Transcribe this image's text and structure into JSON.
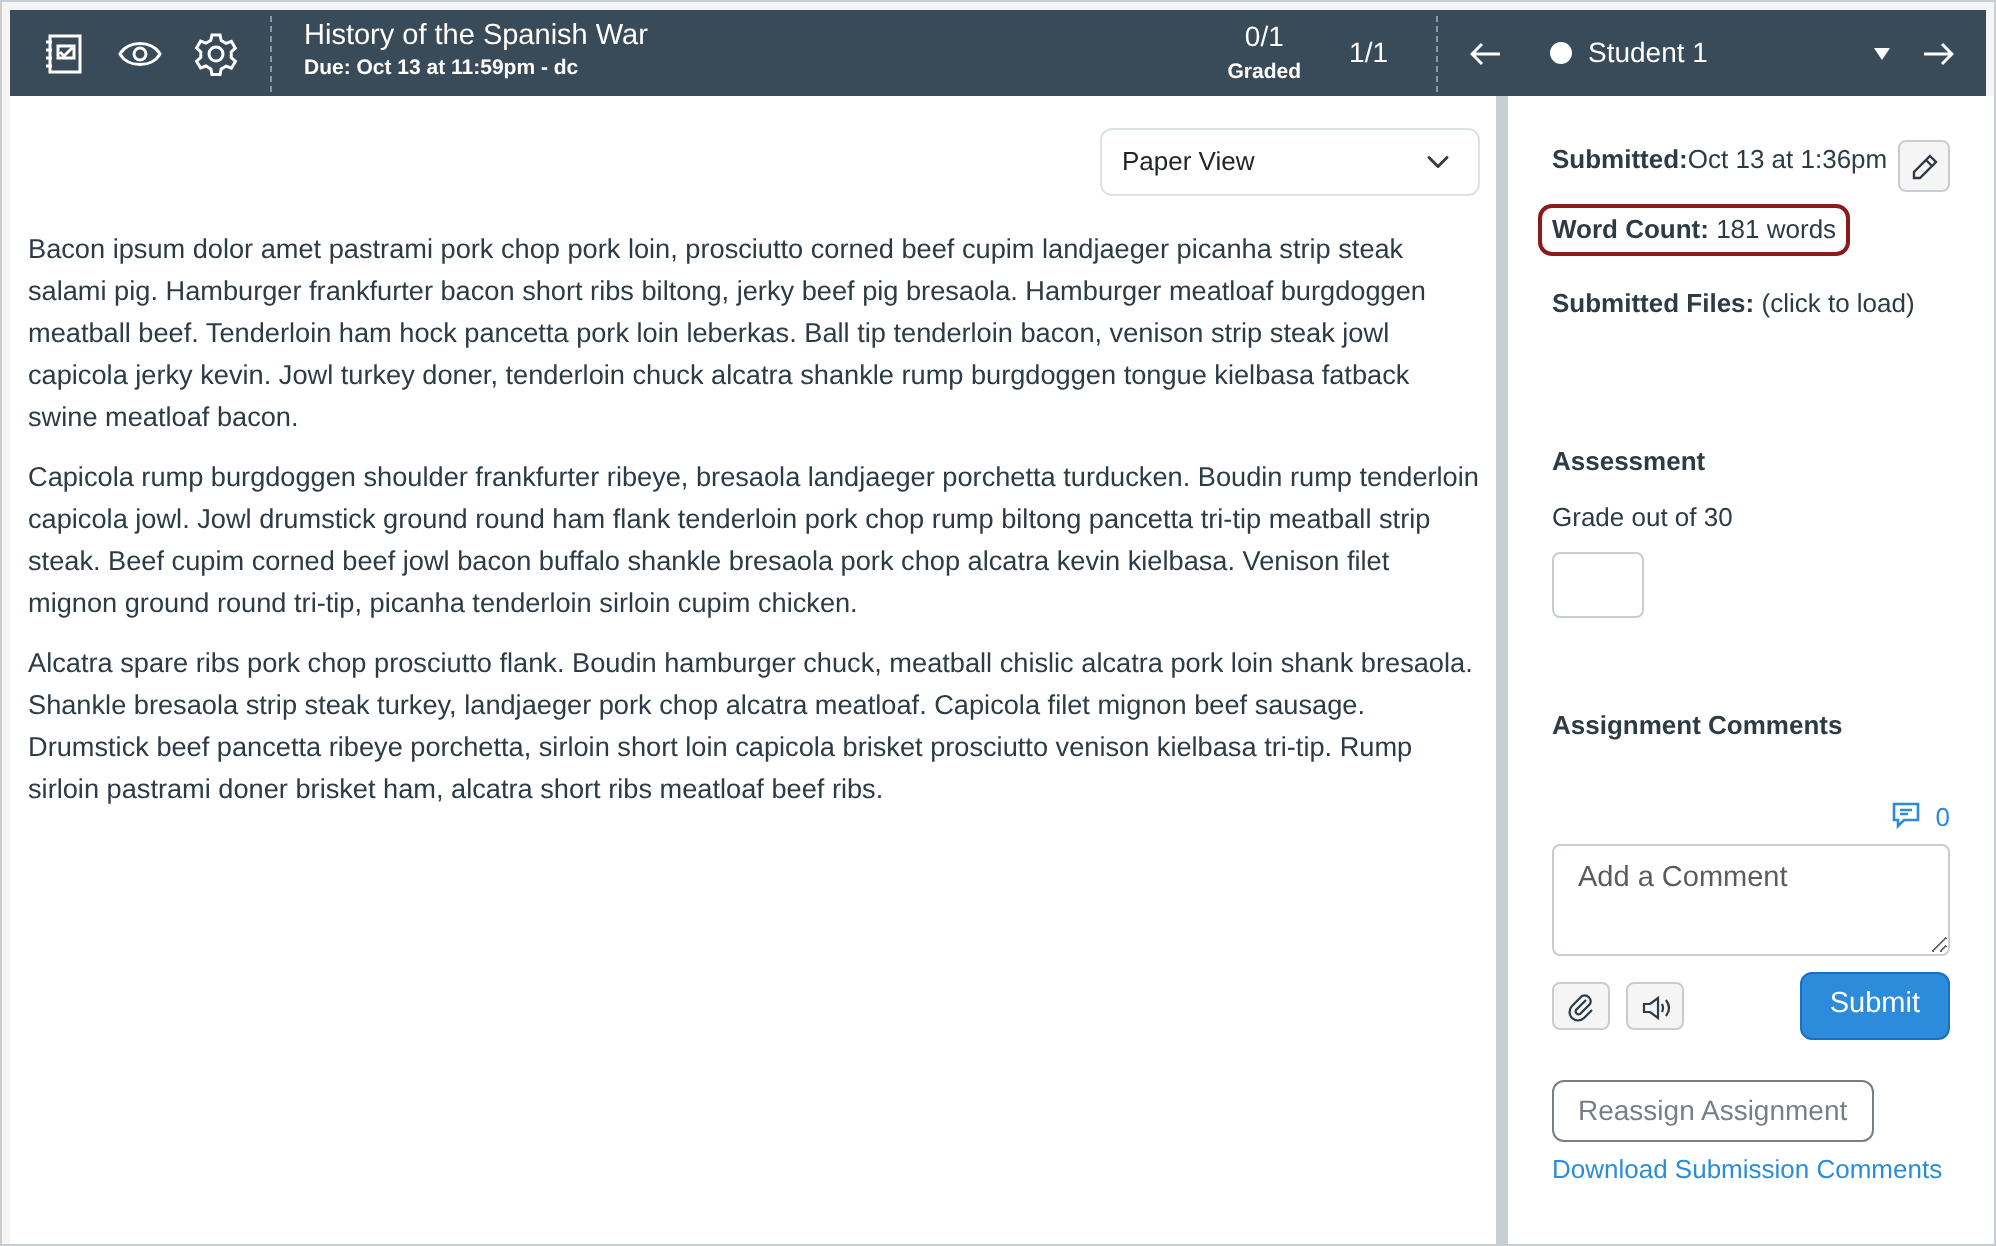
{
  "header": {
    "title": "History of the Spanish War",
    "due": "Due: Oct 13 at 11:59pm - dc",
    "graded_count": "0/1",
    "graded_label": "Graded",
    "position": "1/1",
    "student": "Student 1"
  },
  "submission": {
    "view_select": "Paper View",
    "paragraphs": [
      "Bacon ipsum dolor amet pastrami pork chop pork loin, prosciutto corned beef cupim landjaeger picanha strip steak salami pig. Hamburger frankfurter bacon short ribs biltong, jerky beef pig bresaola. Hamburger meatloaf burgdoggen meatball beef. Tenderloin ham hock pancetta pork loin leberkas. Ball tip tenderloin bacon, venison strip steak jowl capicola jerky kevin. Jowl turkey doner, tenderloin chuck alcatra shankle rump burgdoggen tongue kielbasa fatback swine meatloaf bacon.",
      "Capicola rump burgdoggen shoulder frankfurter ribeye, bresaola landjaeger porchetta turducken. Boudin rump tenderloin capicola jowl. Jowl drumstick ground round ham flank tenderloin pork chop rump biltong pancetta tri-tip meatball strip steak. Beef cupim corned beef jowl bacon buffalo shankle bresaola pork chop alcatra kevin kielbasa. Venison filet mignon ground round tri-tip, picanha tenderloin sirloin cupim chicken.",
      "Alcatra spare ribs pork chop prosciutto flank. Boudin hamburger chuck, meatball chislic alcatra pork loin shank bresaola. Shankle bresaola strip steak turkey, landjaeger pork chop alcatra meatloaf. Capicola filet mignon beef sausage. Drumstick beef pancetta ribeye porchetta, sirloin short loin capicola brisket prosciutto venison kielbasa tri-tip. Rump sirloin pastrami doner brisket ham, alcatra short ribs meatloaf beef ribs."
    ]
  },
  "sidebar": {
    "details": [
      {
        "label": "Submitted:",
        "value": "Oct 13 at 1:36pm",
        "highlighted": false
      },
      {
        "label": "Word Count:",
        "value": " 181 words",
        "highlighted": true
      },
      {
        "label": "Submitted Files:",
        "value": " (click to load)",
        "highlighted": false
      }
    ],
    "assessment_heading": "Assessment",
    "grade_label": "Grade out of 30",
    "comments_heading": "Assignment Comments",
    "comment_count": "0",
    "comment_placeholder": "Add a Comment",
    "submit": "Submit",
    "reassign": "Reassign Assignment",
    "reassign_disabled": true,
    "download_link": "Download Submission Comments"
  }
}
